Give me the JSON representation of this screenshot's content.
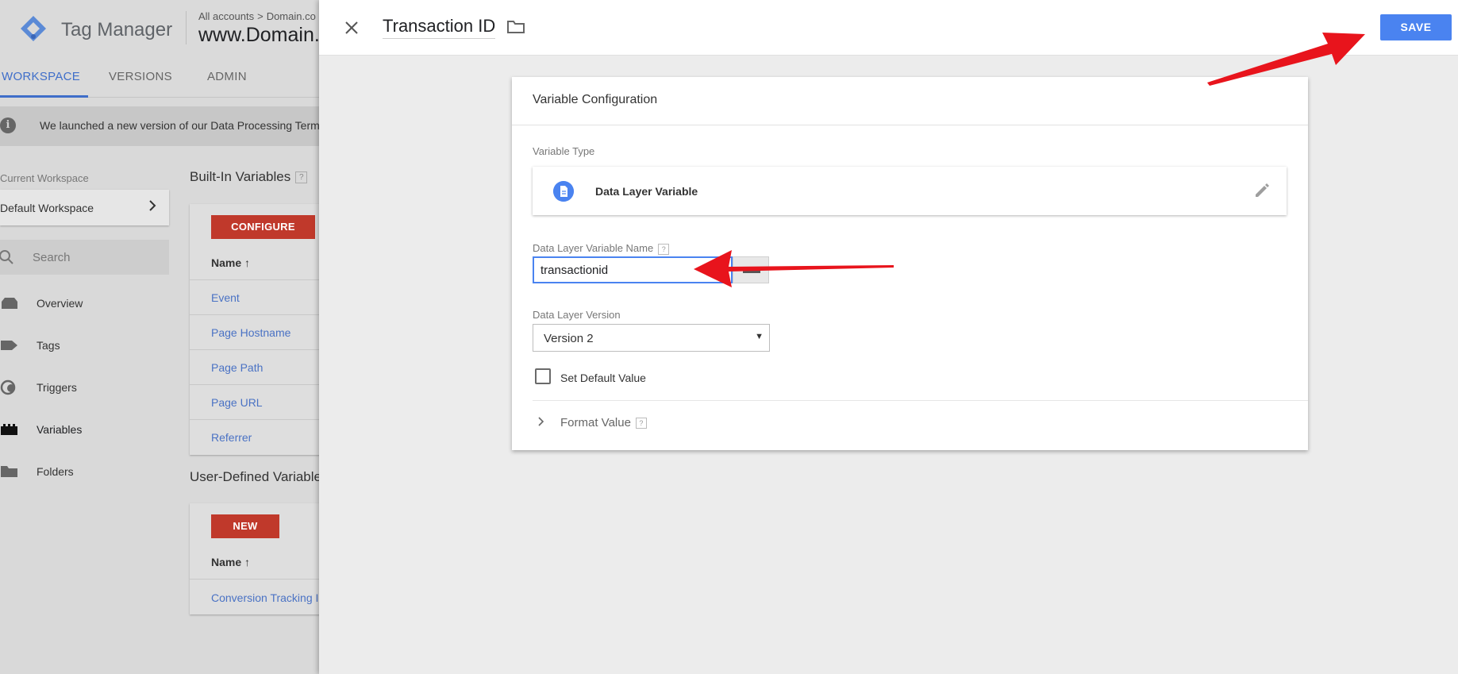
{
  "app": {
    "name": "Tag Manager",
    "breadcrumb_root": "All accounts",
    "breadcrumb_account": "Domain.co",
    "container_name": "www.Domain.com"
  },
  "tabs": [
    {
      "label": "WORKSPACE",
      "active": true
    },
    {
      "label": "VERSIONS",
      "active": false
    },
    {
      "label": "ADMIN",
      "active": false
    }
  ],
  "notice": {
    "icon": "info-icon",
    "text": "We launched a new version of our Data Processing Terms"
  },
  "sidebar": {
    "current_workspace_label": "Current Workspace",
    "workspace_name": "Default Workspace",
    "search_placeholder": "Search",
    "items": [
      {
        "label": "Overview",
        "icon": "overview-icon",
        "active": false
      },
      {
        "label": "Tags",
        "icon": "tag-icon",
        "active": false
      },
      {
        "label": "Triggers",
        "icon": "trigger-icon",
        "active": false
      },
      {
        "label": "Variables",
        "icon": "variables-icon",
        "active": true
      },
      {
        "label": "Folders",
        "icon": "folder-icon",
        "active": false
      }
    ]
  },
  "builtin": {
    "title": "Built-In Variables",
    "help": "?",
    "button": "CONFIGURE",
    "col_name": "Name",
    "rows": [
      "Event",
      "Page Hostname",
      "Page Path",
      "Page URL",
      "Referrer"
    ]
  },
  "userdefined": {
    "title": "User-Defined Variables",
    "button": "NEW",
    "col_name": "Name",
    "rows": [
      "Conversion Tracking ID"
    ]
  },
  "panel": {
    "title": "Transaction ID",
    "save_label": "SAVE",
    "card_title": "Variable Configuration",
    "variable_type_label": "Variable Type",
    "variable_type_value": "Data Layer Variable",
    "dlv_name_label": "Data Layer Variable Name",
    "dlv_name_help": "?",
    "dlv_name_value": "transactionid",
    "dl_version_label": "Data Layer Version",
    "dl_version_value": "Version 2",
    "set_default_label": "Set Default Value",
    "set_default_checked": false,
    "format_value_label": "Format Value",
    "format_value_help": "?"
  },
  "colors": {
    "accent": "#4a83f0",
    "red_button": "#c0392b",
    "annotation_arrow": "#e8141c"
  }
}
